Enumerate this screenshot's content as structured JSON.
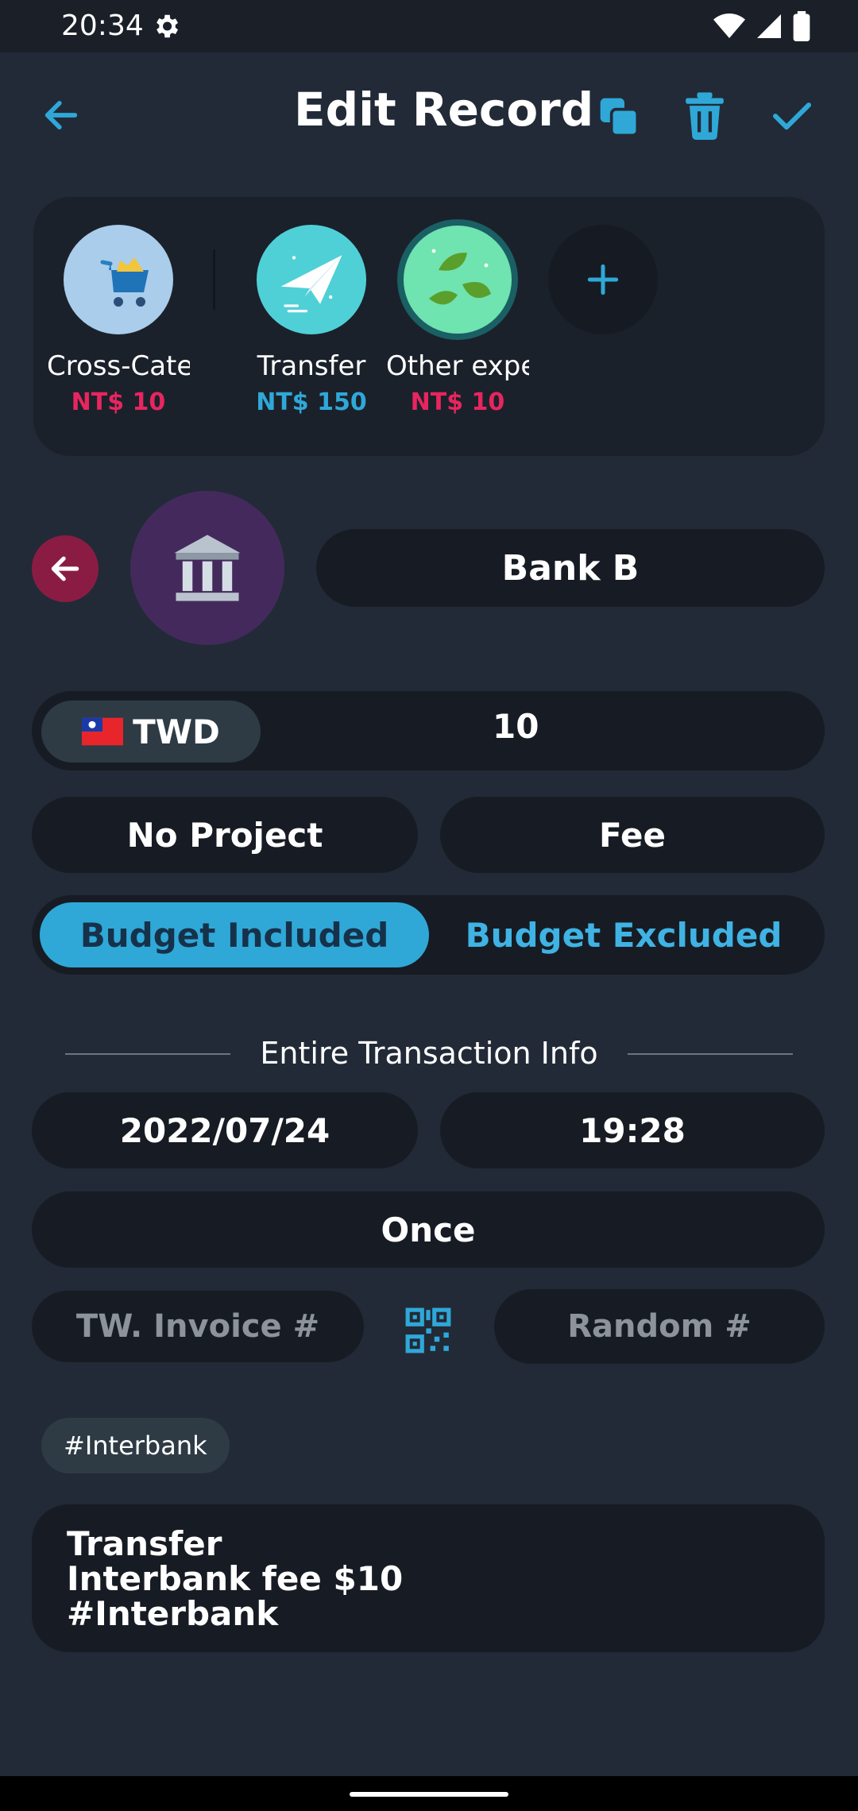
{
  "status_bar": {
    "time": "20:34"
  },
  "header": {
    "title": "Edit Record"
  },
  "categories": [
    {
      "name": "Cross-Category",
      "amount": "NT$ 10",
      "color": "#e8255f"
    },
    {
      "name": "Transfer",
      "amount": "NT$ 150",
      "color": "#2fa8d8"
    },
    {
      "name": "Other expenses",
      "amount": "NT$ 10",
      "color": "#e8255f"
    }
  ],
  "account": {
    "name": "Bank B"
  },
  "amount": {
    "currency": "TWD",
    "value": "10"
  },
  "project": {
    "label": "No Project"
  },
  "subcategory": {
    "label": "Fee"
  },
  "budget": {
    "included": "Budget Included",
    "excluded": "Budget Excluded",
    "selected": "included"
  },
  "section": {
    "title": "Entire Transaction Info"
  },
  "datetime": {
    "date": "2022/07/24",
    "time": "19:28"
  },
  "repeat": {
    "label": "Once"
  },
  "invoice": {
    "placeholder": "TW. Invoice #",
    "random_placeholder": "Random #"
  },
  "tags": [
    "#Interbank"
  ],
  "note": {
    "lines": [
      "Transfer",
      "Interbank fee $10",
      "#Interbank"
    ]
  },
  "colors": {
    "accent": "#2fa8d8",
    "expense": "#e8255f",
    "background": "#222a37"
  }
}
